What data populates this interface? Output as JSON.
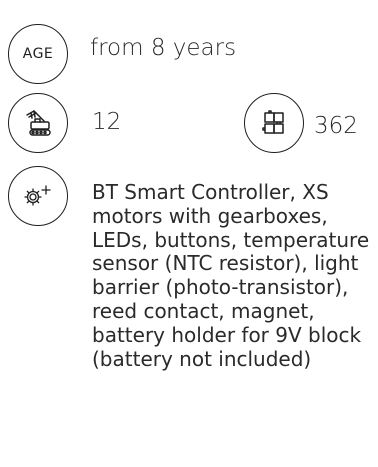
{
  "age": {
    "badge_label": "AGE",
    "value": "from 8 years"
  },
  "models": {
    "icon": "model-vehicle-icon",
    "count": "12"
  },
  "parts": {
    "icon": "building-blocks-icon",
    "count": "362"
  },
  "features": {
    "icon": "gears-plus-icon",
    "text": "BT Smart Controller, XS motors with gearboxes, LEDs, buttons, temperature sensor (NTC resistor), light barrier (photo-transistor), reed contact, magnet, battery holder for 9V block (battery not included)"
  }
}
